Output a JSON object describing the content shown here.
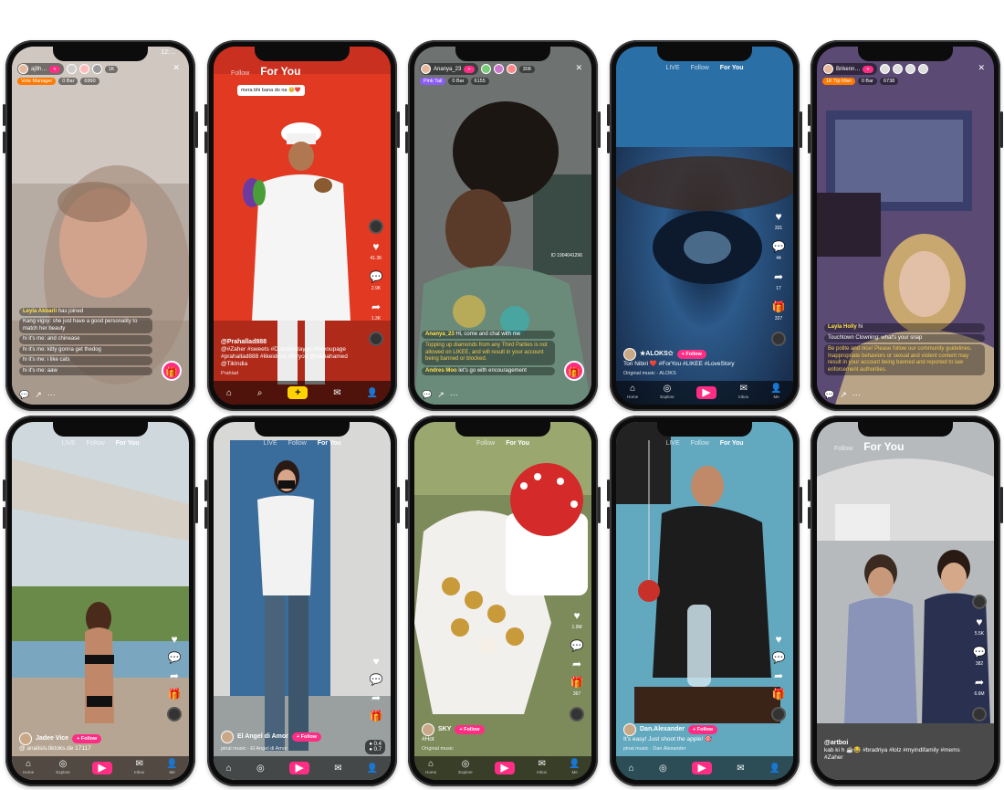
{
  "phones": [
    {
      "id": "p1",
      "type": "live",
      "status_time": "12:…",
      "host_name": "aj9h…",
      "counter": "1K",
      "badges": [
        "Vote Manager",
        "0 Bar",
        "6990"
      ],
      "chat": [
        {
          "user": "Leyla Akbarli",
          "text": "has joined",
          "system": false
        },
        {
          "user": "",
          "text": "Kang vigsy: she just have a good personality to match her beauty",
          "system": false
        },
        {
          "user": "",
          "text": "hi it's me: and chinease",
          "system": false
        },
        {
          "user": "",
          "text": "hi it's me: kitty gonna get thedog",
          "system": false
        },
        {
          "user": "",
          "text": "hi it's me: i like cats",
          "system": false
        },
        {
          "user": "",
          "text": "hi it's me: aaw",
          "system": false
        }
      ],
      "bg": "#b9b1a9"
    },
    {
      "id": "p2",
      "type": "feed",
      "tabs": [
        "Follow",
        "For You"
      ],
      "active_tab": "For You",
      "bubble_text": "mera bhi bana do na 🥺❤️",
      "username": "@Prahallad888",
      "caption": "@#Zaher #sweets #DubaiMalayali #foryoupage #prahallad888 #likeideos #foryou @sikhahamed @TikIndia",
      "music": "Prahlad",
      "counts": [
        "41.3K",
        "2.9K",
        "1.3K"
      ],
      "bg": "#e03a25"
    },
    {
      "id": "p3",
      "type": "live",
      "status_time": "12:…",
      "host_name": "Ananya_23",
      "counter": "308",
      "badges": [
        "Pink Tail",
        "0 Bar",
        "6155"
      ],
      "chat": [
        {
          "user": "Ananya_23",
          "text": "Hi, come and chat with me",
          "system": false
        },
        {
          "user": "",
          "text": "Topping up diamonds from any Third Parties is not allowed on LIKEE, and will result in your account being banned or blocked.",
          "system": true
        },
        {
          "user": "Andres Moo",
          "text": "let's go with encouragement",
          "system": false
        }
      ],
      "cam_id": "ID 1904041296",
      "bg": "#6e7470"
    },
    {
      "id": "p4",
      "type": "feed",
      "tabs": [
        "LIVE",
        "Follow",
        "For You"
      ],
      "active_tab": "For You",
      "username": "★ALOKS✩",
      "caption": "Tori Nibiri ❤️ #ForYou #LIKEE #LoveStory",
      "music": "Original music - ALOKS",
      "counts": [
        "331",
        "44",
        "17",
        "327"
      ],
      "bg": "#28527a"
    },
    {
      "id": "p5",
      "type": "live",
      "status_time": "12:…",
      "host_name": "Brikenn…",
      "counter": "",
      "badges": [
        "1K Tip Man",
        "0 Bar",
        "6738"
      ],
      "chat": [
        {
          "user": "Layla Holly",
          "text": "hi",
          "system": false
        },
        {
          "user": "",
          "text": "Touchtown Clowning: what's your snap",
          "system": false
        },
        {
          "user": "",
          "text": "Be polite and nice! Please follow our community guidelines. Inappropriate behaviors or sexual and violent content may result in your account being banned and reported to law enforcement authorities.",
          "system": true
        }
      ],
      "bg": "#5a4a73"
    },
    {
      "id": "p6",
      "type": "feed",
      "tabs": [
        "LIVE",
        "Follow",
        "For You"
      ],
      "active_tab": "For You",
      "username": "Jadee Vice",
      "caption": "@ analisis.tiktoks.de 17117",
      "music": "",
      "counts": [
        "",
        "",
        "",
        ""
      ],
      "bg": "#8ea6b8"
    },
    {
      "id": "p7",
      "type": "feed",
      "tabs": [
        "LIVE",
        "Follow",
        "For You"
      ],
      "active_tab": "For You",
      "username": "El Angel di Amor",
      "caption": "",
      "music": "pinal music - El Angel di Amor",
      "counts": [
        "0.4",
        "0.7"
      ],
      "bg": "#5b86a6"
    },
    {
      "id": "p8",
      "type": "feed",
      "tabs": [
        "Follow",
        "For You"
      ],
      "active_tab": "For You",
      "username": "SKY",
      "caption": "#Hot",
      "music": "Original music",
      "counts": [
        "1.9M",
        "",
        "",
        "367"
      ],
      "bg": "#8e9a6a"
    },
    {
      "id": "p9",
      "type": "feed",
      "tabs": [
        "LIVE",
        "Follow",
        "For You"
      ],
      "active_tab": "For You",
      "username": "Dan.Alexander",
      "caption": "It's easy! Just shoot the apple! 🎯",
      "music": "pinal music - Dan Alexander",
      "counts": [
        "",
        "",
        "",
        ""
      ],
      "bg": "#5d9bb0"
    },
    {
      "id": "p10",
      "type": "feed",
      "tabs": [
        "Follow",
        "For You"
      ],
      "active_tab": "For You",
      "username": "@artboi",
      "caption": "kab ki h ☕😂 #bradriya #lolz #myindifamily #mems #Zaher",
      "music": "",
      "counts": [
        "5.5K",
        "9.3M",
        "382",
        "6.6M"
      ],
      "bg": "#9aa0a6"
    }
  ],
  "nav": {
    "home": "Home",
    "explore": "Explore",
    "inbox": "Inbox",
    "me": "Me"
  },
  "colors": {
    "accent": "#ff2d84",
    "live_tag": "#8b5cf6",
    "yellow": "#ffd400"
  }
}
